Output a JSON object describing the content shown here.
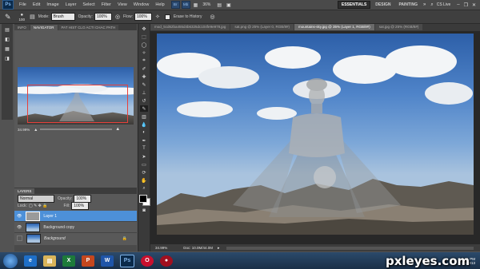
{
  "app": {
    "logo": "Ps"
  },
  "menu": {
    "items": [
      "File",
      "Edit",
      "Image",
      "Layer",
      "Select",
      "Filter",
      "View",
      "Window",
      "Help"
    ],
    "zoom_display": "36%",
    "workspaces": [
      "ESSENTIALS",
      "DESIGN",
      "PAINTING"
    ],
    "overflow": "»",
    "cs_live": "CS Live"
  },
  "options": {
    "brush_size": "100",
    "mode_label": "Mode:",
    "mode_value": "Brush",
    "opacity_label": "Opacity:",
    "opacity_value": "100%",
    "flow_label": "Flow:",
    "flow_value": "100%",
    "erase_to_history": "Erase to History"
  },
  "left_panel": {
    "top_tabs": [
      "INFO",
      "NAVIGATOR",
      "PAT HIST CLO ACTI CHAC PATH"
    ],
    "navigator_zoom": "34.99%",
    "layers_tab": "LAYERS",
    "blend_mode": "Normal",
    "opacity_label": "Opacity:",
    "opacity_value": "100%",
    "lock_label": "Lock:",
    "fill_label": "Fill:",
    "fill_value": "100%",
    "layers": [
      {
        "name": "Layer 1",
        "selected": true
      },
      {
        "name": "Background copy",
        "selected": false
      },
      {
        "name": "Background",
        "selected": false
      }
    ]
  },
  "doc": {
    "tabs": [
      "mod_5cd62ba455d4b6325dc104fe9e978.jpg",
      "sat.png @ 25% (Layer 0, RGB/8#)",
      "mountains-sky.jpg @ 35% (Layer 1, RGB/8#)",
      "sat.jpg @ 25% (RGB/8#)"
    ],
    "status_zoom": "34.99%",
    "status_doc": "Doc: 10.0M/44.0M"
  },
  "taskbar": {
    "apps": [
      "ie",
      "explorer",
      "excel",
      "powerpoint",
      "word",
      "photoshop",
      "opera",
      "other"
    ],
    "time": "1:21 PM",
    "date": "3/1/2013"
  },
  "watermark": "pxleyes.com",
  "colors": {
    "selection_blue": "#4d90d8",
    "navigator_box": "#e8403a",
    "taskbar": "#1f3a58"
  }
}
